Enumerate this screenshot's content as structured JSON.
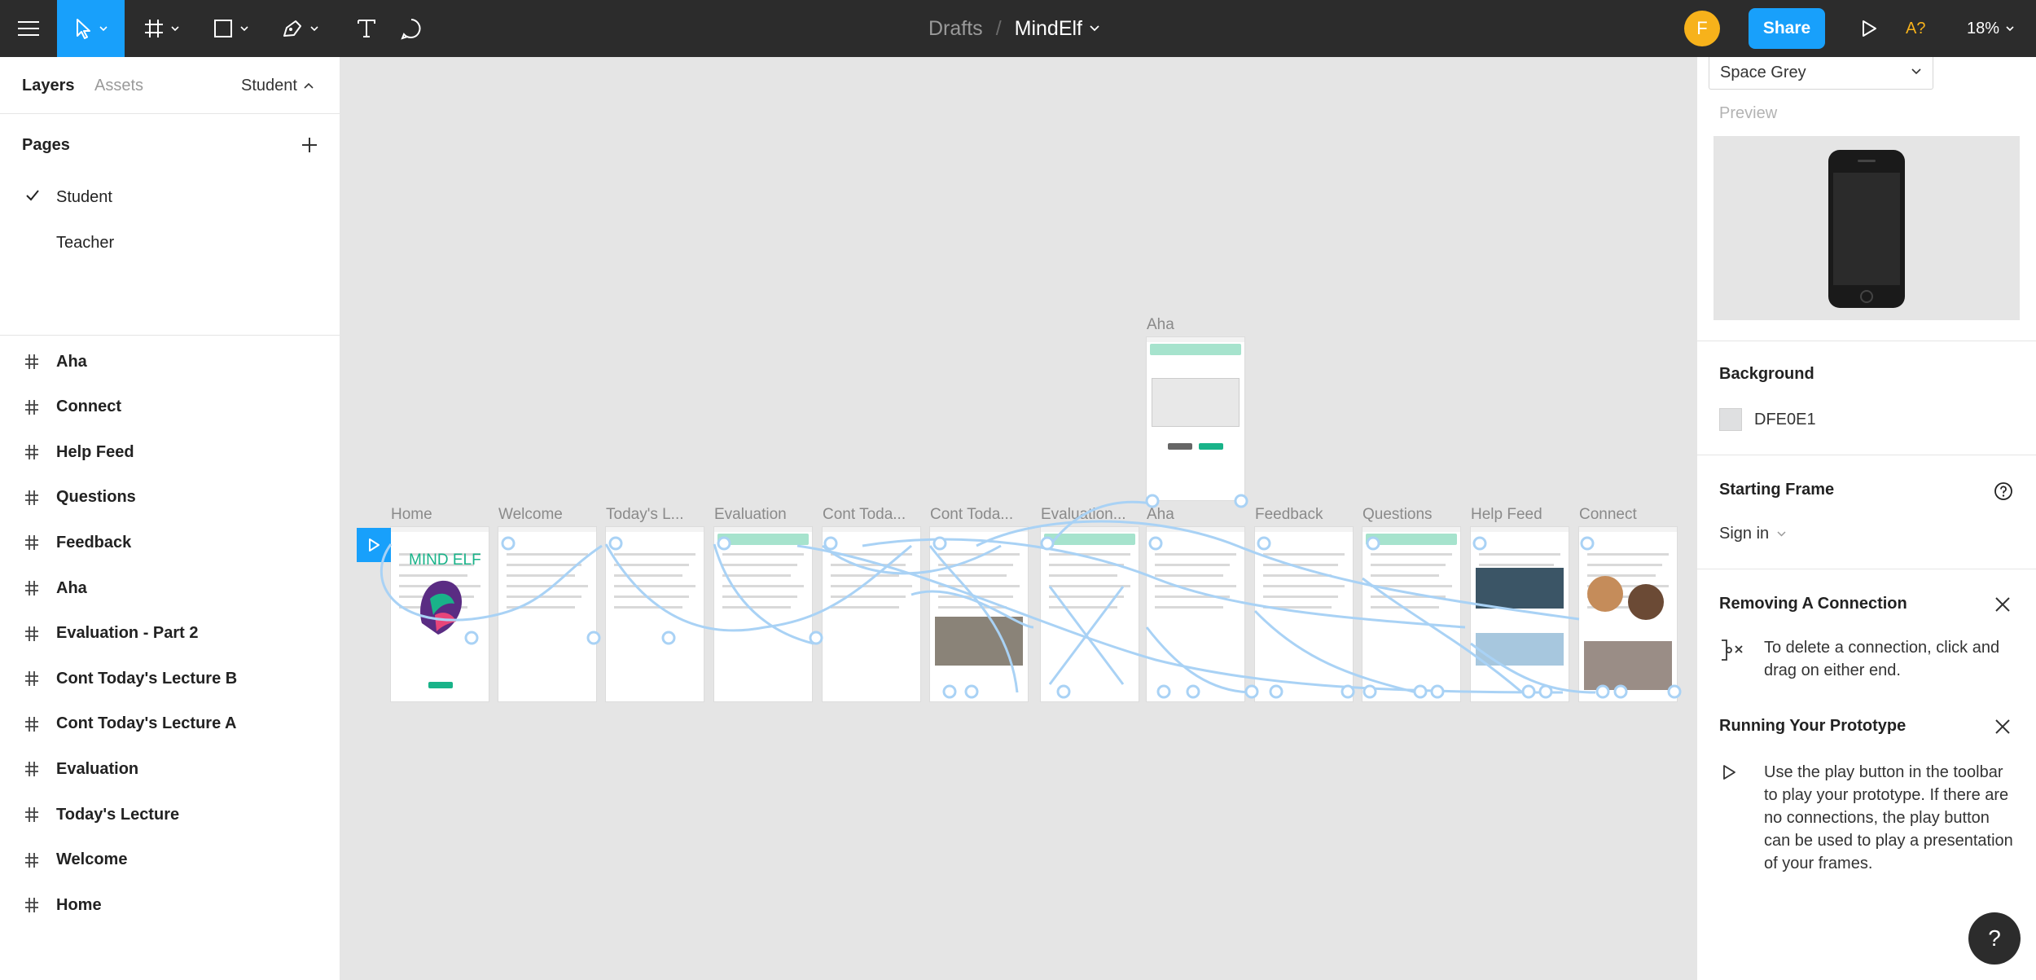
{
  "toolbar": {
    "breadcrumb_parent": "Drafts",
    "breadcrumb_sep": "/",
    "file_name": "MindElf",
    "avatar_initial": "F",
    "share_label": "Share",
    "a11y_label": "A?",
    "zoom_level": "18%",
    "icons": [
      "menu-icon",
      "move-tool-icon",
      "frame-tool-icon",
      "shape-tool-icon",
      "pen-tool-icon",
      "text-tool-icon",
      "comment-tool-icon",
      "play-icon"
    ],
    "accent_color": "#18a0fb",
    "avatar_color": "#f7b21b"
  },
  "left_panel": {
    "tabs": {
      "layers": "Layers",
      "assets": "Assets",
      "current_page": "Student"
    },
    "pages_title": "Pages",
    "pages": [
      {
        "label": "Student",
        "selected": true
      },
      {
        "label": "Teacher",
        "selected": false
      }
    ],
    "layers": [
      "Aha",
      "Connect",
      "Help Feed",
      "Questions",
      "Feedback",
      "Aha",
      "Evaluation - Part 2",
      "Cont Today's Lecture B",
      "Cont Today's Lecture A",
      "Evaluation",
      "Today's Lecture",
      "Welcome",
      "Home"
    ]
  },
  "canvas": {
    "frame_labels": [
      "Home",
      "Welcome",
      "Today's L...",
      "Evaluation",
      "Cont Toda...",
      "Cont Toda...",
      "Evaluation...",
      "Aha",
      "Feedback",
      "Questions",
      "Help Feed",
      "Connect"
    ],
    "top_frame_label": "Aha",
    "home_frame_title": "MIND ELF",
    "connection_color": "#a9d2f5"
  },
  "right_panel": {
    "device_value": "Space Grey",
    "preview_label": "Preview",
    "background_title": "Background",
    "background_hex": "DFE0E1",
    "starting_frame_title": "Starting Frame",
    "starting_frame_value": "Sign in",
    "removing_title": "Removing A Connection",
    "removing_text": "To delete a connection, click and drag on either end.",
    "running_title": "Running Your Prototype",
    "running_text": "Use the play button in the toolbar to play your prototype. If there are no connections, the play button can be used to play a presentation of your frames."
  },
  "help_fab": "?"
}
